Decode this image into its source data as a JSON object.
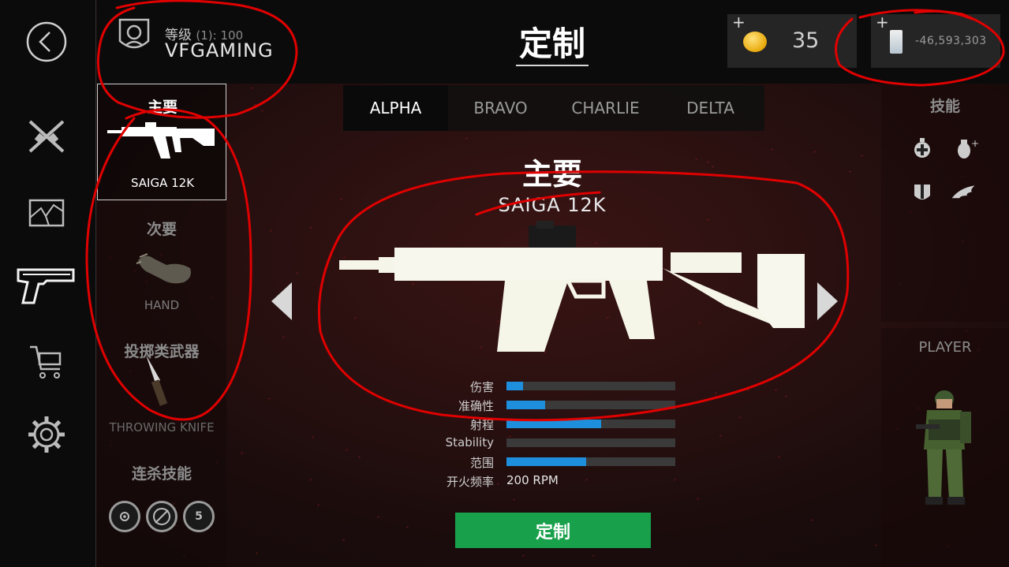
{
  "header": {
    "title": "定制",
    "profile": {
      "level_label": "等级",
      "level_sub": "(1): 100",
      "name": "VFGAMING"
    },
    "currencies": {
      "coins": "35",
      "cash": "-46,593,303",
      "add_symbol": "+"
    }
  },
  "nav": {
    "icons": [
      "back-icon",
      "crossed-rifles-icon",
      "shattered-window-icon",
      "pistol-icon",
      "shopping-cart-icon",
      "gear-icon"
    ]
  },
  "loadout": {
    "primary": {
      "header": "主要",
      "name": "SAIGA 12K"
    },
    "secondary": {
      "header": "次要",
      "name": "HAND"
    },
    "throwable": {
      "header": "投掷类武器",
      "name": "THROWING KNIFE"
    },
    "killstreak": {
      "header": "连杀技能",
      "badge_value": "5"
    }
  },
  "tabs": [
    "ALPHA",
    "BRAVO",
    "CHARLIE",
    "DELTA"
  ],
  "active_tab": "ALPHA",
  "weapon": {
    "slot_label": "主要",
    "name": "SAIGA 12K",
    "stats": [
      {
        "label": "伤害",
        "level": 0.1
      },
      {
        "label": "准确性",
        "level": 0.23
      },
      {
        "label": "射程",
        "level": 0.56
      },
      {
        "label": "Stability",
        "level": 0.0
      },
      {
        "label": "范围",
        "level": 0.47
      }
    ],
    "fire_rate_label": "开火频率",
    "fire_rate_value": "200 RPM",
    "customize_label": "定制"
  },
  "right_panel": {
    "skills_header": "技能",
    "player_header": "PLAYER"
  },
  "colors": {
    "accent_green": "#18a04a",
    "stat_fill": "#1d8fdc",
    "annotation_red": "#e00000",
    "coin_gold": "#e8a90b"
  }
}
